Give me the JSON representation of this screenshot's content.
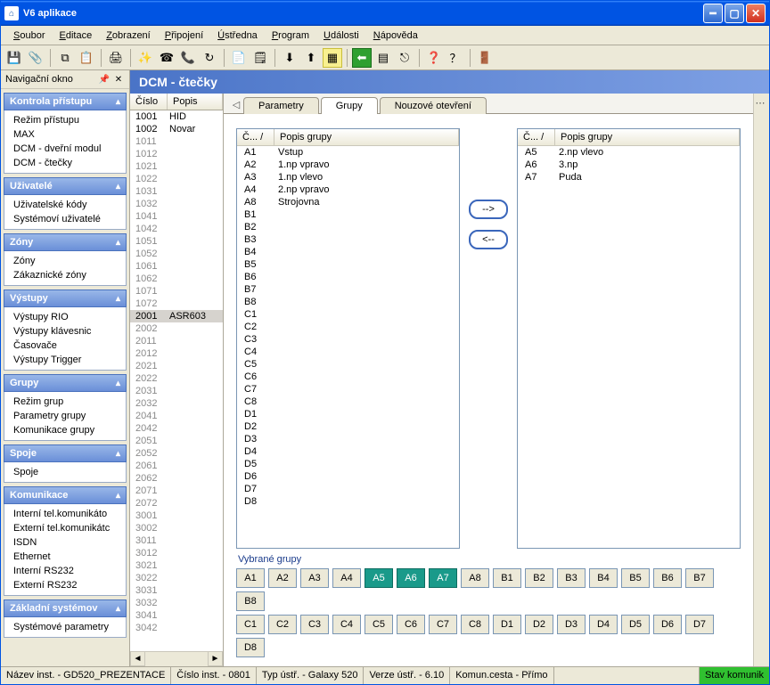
{
  "window": {
    "title": "V6 aplikace"
  },
  "menu": {
    "items": [
      {
        "label": "Soubor",
        "ul": 0
      },
      {
        "label": "Editace",
        "ul": 0
      },
      {
        "label": "Zobrazení",
        "ul": 0
      },
      {
        "label": "Připojení",
        "ul": 0
      },
      {
        "label": "Ústředna",
        "ul": 0
      },
      {
        "label": "Program",
        "ul": 0
      },
      {
        "label": "Události",
        "ul": 0
      },
      {
        "label": "Nápověda",
        "ul": 0
      }
    ]
  },
  "toolbar": {
    "icons": [
      "save-icon",
      "paperclip-icon",
      "sep",
      "copy-icon",
      "paste-icon",
      "sep",
      "print-icon",
      "sep",
      "wand-icon",
      "dial-yellow-icon",
      "dial-blue-icon",
      "refresh-icon",
      "sep",
      "report-icon",
      "log-icon",
      "sep",
      "download-icon",
      "upload-icon",
      "page-yellow-icon",
      "sep",
      "back-green-icon",
      "form-icon",
      "exit-icon",
      "sep",
      "help-icon",
      "whatsthis-icon",
      "sep",
      "door-icon"
    ]
  },
  "nav": {
    "title": "Navigační okno",
    "groups": [
      {
        "title": "Kontrola přístupu",
        "items": [
          "Režim přístupu",
          "MAX",
          "DCM - dveřní modul",
          "DCM - čtečky"
        ]
      },
      {
        "title": "Uživatelé",
        "items": [
          "Uživatelské kódy",
          "Systémoví uživatelé"
        ]
      },
      {
        "title": "Zóny",
        "items": [
          "Zóny",
          "Zákaznické zóny"
        ]
      },
      {
        "title": "Výstupy",
        "items": [
          "Výstupy RIO",
          "Výstupy klávesnic",
          "Časovače",
          "Výstupy Trigger"
        ]
      },
      {
        "title": "Grupy",
        "items": [
          "Režim grup",
          "Parametry grupy",
          "Komunikace grupy"
        ]
      },
      {
        "title": "Spoje",
        "items": [
          "Spoje"
        ]
      },
      {
        "title": "Komunikace",
        "items": [
          "Interní tel.komunikáto",
          "Externí tel.komunikátc",
          "ISDN",
          "Ethernet",
          "Interní RS232",
          "Externí RS232"
        ]
      },
      {
        "title": "Základní systémov",
        "items": [
          "Systémové parametry"
        ]
      }
    ]
  },
  "list": {
    "title": "DCM - čtečky",
    "columns": [
      "Číslo",
      "Popis"
    ],
    "rows": [
      {
        "n": "1001",
        "d": "HID",
        "dim": false
      },
      {
        "n": "1002",
        "d": "Novar",
        "dim": false
      },
      {
        "n": "1011",
        "d": "",
        "dim": true
      },
      {
        "n": "1012",
        "d": "",
        "dim": true
      },
      {
        "n": "1021",
        "d": "",
        "dim": true
      },
      {
        "n": "1022",
        "d": "",
        "dim": true
      },
      {
        "n": "1031",
        "d": "",
        "dim": true
      },
      {
        "n": "1032",
        "d": "",
        "dim": true
      },
      {
        "n": "1041",
        "d": "",
        "dim": true
      },
      {
        "n": "1042",
        "d": "",
        "dim": true
      },
      {
        "n": "1051",
        "d": "",
        "dim": true
      },
      {
        "n": "1052",
        "d": "",
        "dim": true
      },
      {
        "n": "1061",
        "d": "",
        "dim": true
      },
      {
        "n": "1062",
        "d": "",
        "dim": true
      },
      {
        "n": "1071",
        "d": "",
        "dim": true
      },
      {
        "n": "1072",
        "d": "",
        "dim": true
      },
      {
        "n": "2001",
        "d": "ASR603",
        "dim": false,
        "sel": true
      },
      {
        "n": "2002",
        "d": "",
        "dim": true
      },
      {
        "n": "2011",
        "d": "",
        "dim": true
      },
      {
        "n": "2012",
        "d": "",
        "dim": true
      },
      {
        "n": "2021",
        "d": "",
        "dim": true
      },
      {
        "n": "2022",
        "d": "",
        "dim": true
      },
      {
        "n": "2031",
        "d": "",
        "dim": true
      },
      {
        "n": "2032",
        "d": "",
        "dim": true
      },
      {
        "n": "2041",
        "d": "",
        "dim": true
      },
      {
        "n": "2042",
        "d": "",
        "dim": true
      },
      {
        "n": "2051",
        "d": "",
        "dim": true
      },
      {
        "n": "2052",
        "d": "",
        "dim": true
      },
      {
        "n": "2061",
        "d": "",
        "dim": true
      },
      {
        "n": "2062",
        "d": "",
        "dim": true
      },
      {
        "n": "2071",
        "d": "",
        "dim": true
      },
      {
        "n": "2072",
        "d": "",
        "dim": true
      },
      {
        "n": "3001",
        "d": "",
        "dim": true
      },
      {
        "n": "3002",
        "d": "",
        "dim": true
      },
      {
        "n": "3011",
        "d": "",
        "dim": true
      },
      {
        "n": "3012",
        "d": "",
        "dim": true
      },
      {
        "n": "3021",
        "d": "",
        "dim": true
      },
      {
        "n": "3022",
        "d": "",
        "dim": true
      },
      {
        "n": "3031",
        "d": "",
        "dim": true
      },
      {
        "n": "3032",
        "d": "",
        "dim": true
      },
      {
        "n": "3041",
        "d": "",
        "dim": true
      },
      {
        "n": "3042",
        "d": "",
        "dim": true
      }
    ]
  },
  "detail": {
    "tabs": [
      "Parametry",
      "Grupy",
      "Nouzové otevření"
    ],
    "active_tab": 1,
    "groups_left": {
      "columns": [
        "Č...  /",
        "Popis grupy"
      ],
      "rows": [
        {
          "c": "A1",
          "d": "Vstup"
        },
        {
          "c": "A2",
          "d": "1.np vpravo"
        },
        {
          "c": "A3",
          "d": "1.np vlevo"
        },
        {
          "c": "A4",
          "d": "2.np vpravo"
        },
        {
          "c": "A8",
          "d": "Strojovna"
        },
        {
          "c": "B1",
          "d": ""
        },
        {
          "c": "B2",
          "d": ""
        },
        {
          "c": "B3",
          "d": ""
        },
        {
          "c": "B4",
          "d": ""
        },
        {
          "c": "B5",
          "d": ""
        },
        {
          "c": "B6",
          "d": ""
        },
        {
          "c": "B7",
          "d": ""
        },
        {
          "c": "B8",
          "d": ""
        },
        {
          "c": "C1",
          "d": ""
        },
        {
          "c": "C2",
          "d": ""
        },
        {
          "c": "C3",
          "d": ""
        },
        {
          "c": "C4",
          "d": ""
        },
        {
          "c": "C5",
          "d": ""
        },
        {
          "c": "C6",
          "d": ""
        },
        {
          "c": "C7",
          "d": ""
        },
        {
          "c": "C8",
          "d": ""
        },
        {
          "c": "D1",
          "d": ""
        },
        {
          "c": "D2",
          "d": ""
        },
        {
          "c": "D3",
          "d": ""
        },
        {
          "c": "D4",
          "d": ""
        },
        {
          "c": "D5",
          "d": ""
        },
        {
          "c": "D6",
          "d": ""
        },
        {
          "c": "D7",
          "d": ""
        },
        {
          "c": "D8",
          "d": ""
        }
      ]
    },
    "groups_right": {
      "columns": [
        "Č...  /",
        "Popis grupy"
      ],
      "rows": [
        {
          "c": "A5",
          "d": "2.np vlevo"
        },
        {
          "c": "A6",
          "d": "3.np"
        },
        {
          "c": "A7",
          "d": "Puda"
        }
      ]
    },
    "move_right_label": "-->",
    "move_left_label": "<--",
    "selected_label": "Vybrané grupy",
    "chips_rowA": [
      "A1",
      "A2",
      "A3",
      "A4",
      "A5",
      "A6",
      "A7",
      "A8",
      "B1",
      "B2",
      "B3",
      "B4",
      "B5",
      "B6",
      "B7",
      "B8"
    ],
    "chips_rowB": [
      "C1",
      "C2",
      "C3",
      "C4",
      "C5",
      "C6",
      "C7",
      "C8",
      "D1",
      "D2",
      "D3",
      "D4",
      "D5",
      "D6",
      "D7",
      "D8"
    ],
    "chips_selected": [
      "A5",
      "A6",
      "A7"
    ]
  },
  "status": {
    "cells": [
      "Název inst.  - GD520_PREZENTACE",
      "Číslo inst.  - 0801",
      "Typ ústř.  - Galaxy 520",
      "Verze ústř.  - 6.10",
      "Komun.cesta  - Přímo"
    ],
    "ok": "Stav komunik"
  },
  "colors": {
    "titlebar": "#0054e3",
    "navheader": "#6a8fd8",
    "chip_selected": "#1a9a8a",
    "status_ok": "#30c030"
  }
}
